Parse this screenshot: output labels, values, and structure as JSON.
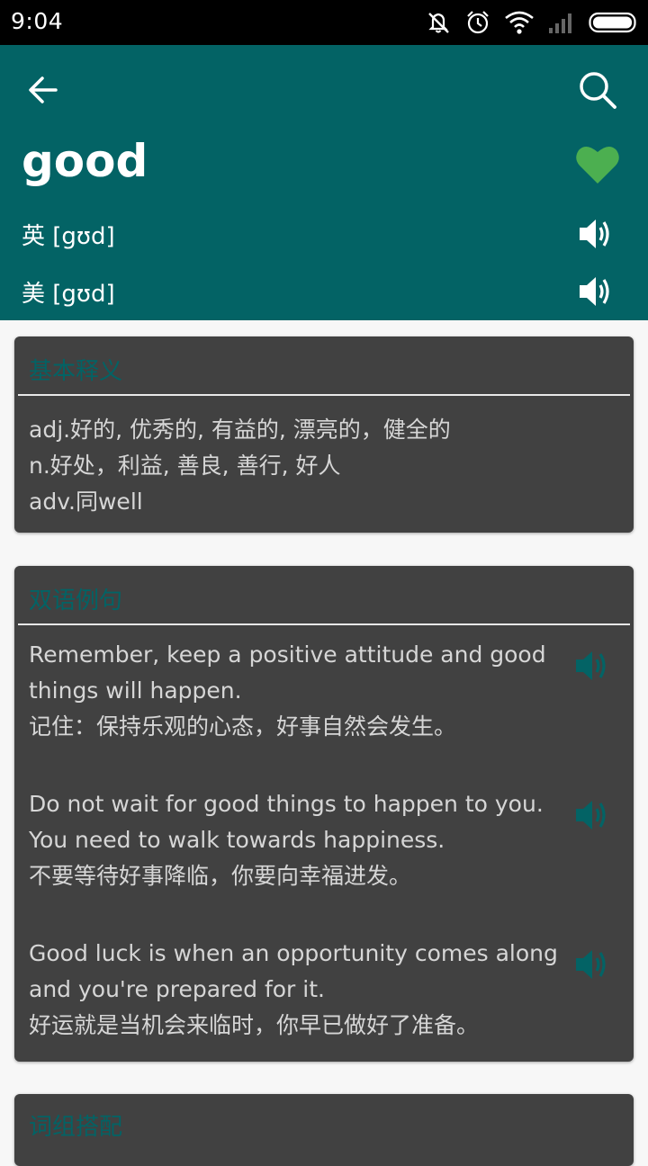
{
  "status_bar": {
    "time": "9:04",
    "icons": [
      "mute-icon",
      "alarm-icon",
      "wifi-icon",
      "signal-icon",
      "battery-icon"
    ]
  },
  "header": {
    "word": "good",
    "uk_phonetic": "英 [gʊd]",
    "us_phonetic": "美 [gʊd]",
    "colors": {
      "background": "#036365",
      "favorite": "#4caf50"
    }
  },
  "basic": {
    "title": "基本释义",
    "lines": [
      "adj.好的, 优秀的, 有益的, 漂亮的，健全的",
      "n.好处，利益, 善良, 善行, 好人",
      "adv.同well"
    ]
  },
  "examples": {
    "title": "双语例句",
    "items": [
      {
        "en1": "Remember, keep a positive attitude and good",
        "en2": "things will happen.",
        "cn": "记住：保持乐观的心态，好事自然会发生。"
      },
      {
        "en1": "Do not wait for good things to happen to you.",
        "en2": "You need to walk towards happiness.",
        "cn": "不要等待好事降临，你要向幸福进发。"
      },
      {
        "en1": "Good luck is when an opportunity comes along",
        "en2": "and you're prepared for it.",
        "cn": "好运就是当机会来临时，你早已做好了准备。"
      }
    ]
  },
  "phrases": {
    "title": "词组搭配"
  }
}
